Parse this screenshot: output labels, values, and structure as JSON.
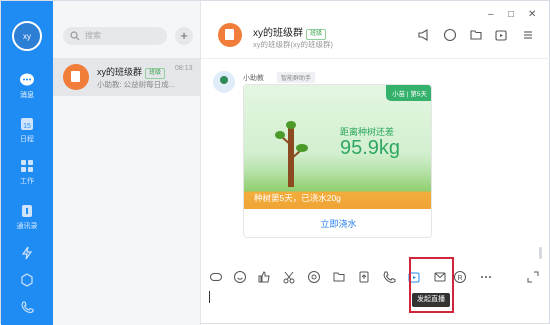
{
  "nav": {
    "avatar": "xy",
    "items": [
      {
        "label": "消息"
      },
      {
        "label": "日程"
      },
      {
        "label": "工作"
      },
      {
        "label": "通讯录"
      }
    ]
  },
  "list": {
    "search_placeholder": "搜索",
    "plus": "+",
    "conversation": {
      "name": "xy的班级群",
      "tag": "班级",
      "time": "08:13",
      "preview": "小助教: 公益树每日成..."
    }
  },
  "header": {
    "title": "xy的班级群",
    "tag": "班级",
    "subtitle": "xy的班级群(xy的班级群)"
  },
  "window": {
    "min": "–",
    "max": "□",
    "close": "✕"
  },
  "message": {
    "sender": "小助教",
    "sender_tag": "智能群助手",
    "card": {
      "badge": "小苗 | 第5天",
      "text": "距离种树还差",
      "value": "95.9kg",
      "footer": "种树第5天，已浇水20g",
      "button": "立即浇水"
    }
  },
  "tooltip": "发起直播"
}
